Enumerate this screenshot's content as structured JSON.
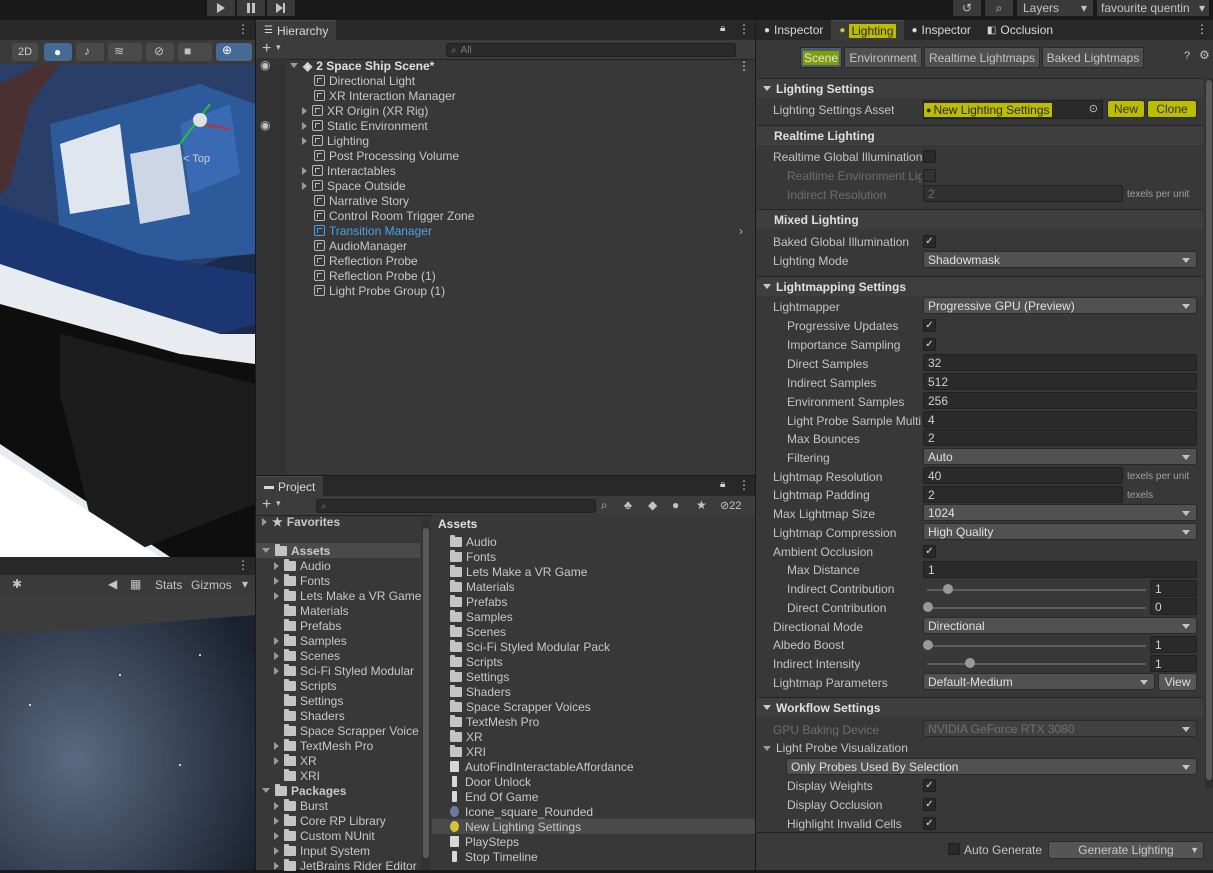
{
  "topbar": {
    "layers_label": "Layers",
    "account_label": "favourite quentin"
  },
  "scene_view": {
    "toolbar_2d": "2D",
    "gizmo_top_label": "< Top"
  },
  "game_view": {
    "stats_label": "Stats",
    "gizmos_label": "Gizmos"
  },
  "hierarchy": {
    "tab_label": "Hierarchy",
    "search_placeholder": "All",
    "scene_name": "2 Space Ship Scene*",
    "items": [
      {
        "label": "Directional Light"
      },
      {
        "label": "XR Interaction Manager"
      },
      {
        "label": "XR Origin (XR Rig)"
      },
      {
        "label": "Static Environment"
      },
      {
        "label": "Lighting"
      },
      {
        "label": "Post Processing Volume"
      },
      {
        "label": "Interactables"
      },
      {
        "label": "Space Outside"
      },
      {
        "label": "Narrative Story"
      },
      {
        "label": "Control Room Trigger Zone"
      },
      {
        "label": "Transition Manager"
      },
      {
        "label": "AudioManager"
      },
      {
        "label": "Reflection Probe"
      },
      {
        "label": "Reflection Probe (1)"
      },
      {
        "label": "Light Probe Group (1)"
      }
    ]
  },
  "project": {
    "tab_label": "Project",
    "hidden_count": "22",
    "tree": {
      "favorites": "Favorites",
      "assets": "Assets",
      "asset_folders": [
        "Audio",
        "Fonts",
        "Lets Make a VR Game",
        "Materials",
        "Prefabs",
        "Samples",
        "Scenes",
        "Sci-Fi Styled Modular",
        "Scripts",
        "Settings",
        "Shaders",
        "Space Scrapper Voice",
        "TextMesh Pro",
        "XR",
        "XRI"
      ],
      "packages": "Packages",
      "package_folders": [
        "Burst",
        "Core RP Library",
        "Custom NUnit",
        "Input System",
        "JetBrains Rider Editor"
      ]
    },
    "assets_header": "Assets",
    "assets_folders": [
      "Audio",
      "Fonts",
      "Lets Make a VR Game",
      "Materials",
      "Prefabs",
      "Samples",
      "Scenes",
      "Sci-Fi Styled Modular Pack",
      "Scripts",
      "Settings",
      "Shaders",
      "Space Scrapper Voices",
      "TextMesh Pro",
      "XR",
      "XRI"
    ],
    "assets_files": [
      "AutoFindInteractableAffordance",
      "Door Unlock",
      "End Of Game",
      "Icone_square_Rounded",
      "New Lighting Settings",
      "PlaySteps",
      "Stop Timeline"
    ]
  },
  "right_tabs": {
    "inspector1": "Inspector",
    "lighting": "Lighting",
    "inspector2": "Inspector",
    "occlusion": "Occlusion"
  },
  "lighting": {
    "subtabs": [
      "Scene",
      "Environment",
      "Realtime Lightmaps",
      "Baked Lightmaps"
    ],
    "lighting_settings_header": "Lighting Settings",
    "lighting_settings_asset_label": "Lighting Settings Asset",
    "lighting_settings_asset_value": "New Lighting Settings",
    "new_button": "New",
    "clone_button": "Clone",
    "realtime_header": "Realtime Lighting",
    "realtime_gi_label": "Realtime Global Illumination",
    "realtime_env_label": "Realtime Environment Lig",
    "indirect_resolution_label": "Indirect Resolution",
    "indirect_resolution_value": "2",
    "texels_per_unit": "texels per unit",
    "mixed_header": "Mixed Lighting",
    "baked_gi_label": "Baked Global Illumination",
    "lighting_mode_label": "Lighting Mode",
    "lighting_mode_value": "Shadowmask",
    "lightmapping_header": "Lightmapping Settings",
    "lightmapper_label": "Lightmapper",
    "lightmapper_value": "Progressive GPU (Preview)",
    "progressive_updates_label": "Progressive Updates",
    "importance_sampling_label": "Importance Sampling",
    "direct_samples_label": "Direct Samples",
    "direct_samples_value": "32",
    "indirect_samples_label": "Indirect Samples",
    "indirect_samples_value": "512",
    "environment_samples_label": "Environment Samples",
    "environment_samples_value": "256",
    "light_probe_sample_label": "Light Probe Sample Multi",
    "light_probe_sample_value": "4",
    "max_bounces_label": "Max Bounces",
    "max_bounces_value": "2",
    "filtering_label": "Filtering",
    "filtering_value": "Auto",
    "lightmap_resolution_label": "Lightmap Resolution",
    "lightmap_resolution_value": "40",
    "lightmap_padding_label": "Lightmap Padding",
    "lightmap_padding_value": "2",
    "texels": "texels",
    "max_lightmap_size_label": "Max Lightmap Size",
    "max_lightmap_size_value": "1024",
    "lightmap_compression_label": "Lightmap Compression",
    "lightmap_compression_value": "High Quality",
    "ambient_occlusion_label": "Ambient Occlusion",
    "max_distance_label": "Max Distance",
    "max_distance_value": "1",
    "indirect_contribution_label": "Indirect Contribution",
    "indirect_contribution_value": "1",
    "direct_contribution_label": "Direct Contribution",
    "direct_contribution_value": "0",
    "directional_mode_label": "Directional Mode",
    "directional_mode_value": "Directional",
    "albedo_boost_label": "Albedo Boost",
    "albedo_boost_value": "1",
    "indirect_intensity_label": "Indirect Intensity",
    "indirect_intensity_value": "1",
    "lightmap_parameters_label": "Lightmap Parameters",
    "lightmap_parameters_value": "Default-Medium",
    "view_button": "View",
    "workflow_header": "Workflow Settings",
    "gpu_baking_label": "GPU Baking Device",
    "gpu_baking_value": "NVIDIA GeForce RTX 3080",
    "light_probe_vis_label": "Light Probe Visualization",
    "probe_filter_value": "Only Probes Used By Selection",
    "display_weights_label": "Display Weights",
    "display_occlusion_label": "Display Occlusion",
    "highlight_invalid_label": "Highlight Invalid Cells",
    "auto_generate_label": "Auto Generate",
    "generate_lighting_button": "Generate Lighting",
    "checkmark": "✓"
  },
  "colors": {
    "highlight": "#bdbd00",
    "selection_blue": "#4aa3e8",
    "panel_bg": "#383838"
  }
}
